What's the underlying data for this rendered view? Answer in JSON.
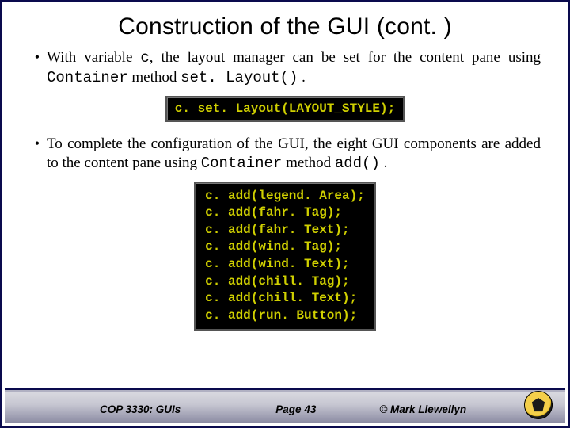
{
  "title": "Construction of the GUI (cont. )",
  "bullets": {
    "b1": {
      "pre": "With variable ",
      "var": "c",
      "mid": ", the layout manager can be set for the content pane using ",
      "cls": "Container",
      "mid2": " method ",
      "method": "set. Layout()",
      "post": " ."
    },
    "b2": {
      "pre": "To complete the configuration of the GUI, the eight GUI components are added to the content pane using ",
      "cls": "Container",
      "mid": " method ",
      "method": "add()",
      "post": " ."
    }
  },
  "code1": "c. set. Layout(LAYOUT_STYLE);",
  "code2": "c. add(legend. Area);\nc. add(fahr. Tag);\nc. add(fahr. Text);\nc. add(wind. Tag);\nc. add(wind. Text);\nc. add(chill. Tag);\nc. add(chill. Text);\nc. add(run. Button);",
  "footer": {
    "course": "COP 3330: GUIs",
    "page": "Page 43",
    "copyright": "© Mark Llewellyn"
  }
}
